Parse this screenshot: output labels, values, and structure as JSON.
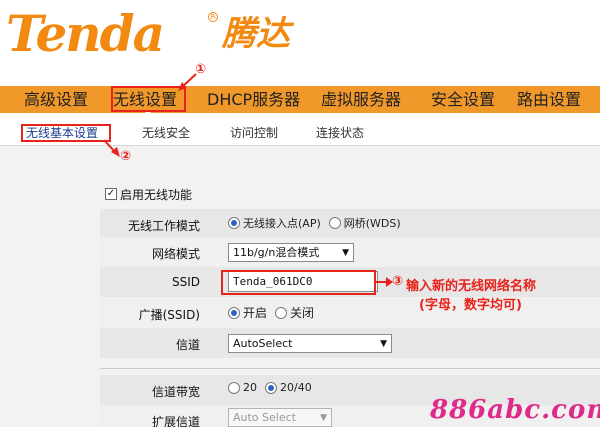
{
  "header": {
    "logo_text": "Tenda",
    "logo_cn": "腾达",
    "logo_mark": "R"
  },
  "main_nav": {
    "items": [
      {
        "label": "高级设置"
      },
      {
        "label": "无线设置"
      },
      {
        "label": "DHCP服务器"
      },
      {
        "label": "虚拟服务器"
      },
      {
        "label": "安全设置"
      },
      {
        "label": "路由设置"
      }
    ],
    "active_index": 1,
    "bar_color": "#f0982a"
  },
  "sub_nav": {
    "items": [
      {
        "label": "无线基本设置"
      },
      {
        "label": "无线安全"
      },
      {
        "label": "访问控制"
      },
      {
        "label": "连接状态"
      }
    ],
    "active_index": 0
  },
  "form": {
    "enable_label": "启用无线功能",
    "enable_checked": true,
    "mode": {
      "label": "无线工作模式",
      "options": [
        "无线接入点(AP)",
        "网桥(WDS)"
      ],
      "selected_index": 0
    },
    "network_mode": {
      "label": "网络模式",
      "value": "11b/g/n混合模式"
    },
    "ssid": {
      "label": "SSID",
      "value": "Tenda_061DC0"
    },
    "broadcast": {
      "label": "广播(SSID)",
      "options": [
        "开启",
        "关闭"
      ],
      "selected_index": 0
    },
    "channel": {
      "label": "信道",
      "value": "AutoSelect"
    },
    "bandwidth": {
      "label": "信道带宽",
      "options": [
        "20",
        "20/40"
      ],
      "selected_index": 1
    },
    "ext_channel": {
      "label": "扩展信道",
      "value": "Auto Select",
      "disabled": true
    }
  },
  "annotations": {
    "num_1": "①",
    "num_2": "②",
    "num_3": "③",
    "ssid_hint": "输入新的无线网络名称",
    "ssid_hint_sub": "(字母，数字均可)",
    "color": "#e8231b"
  },
  "watermark": "886abc.com"
}
